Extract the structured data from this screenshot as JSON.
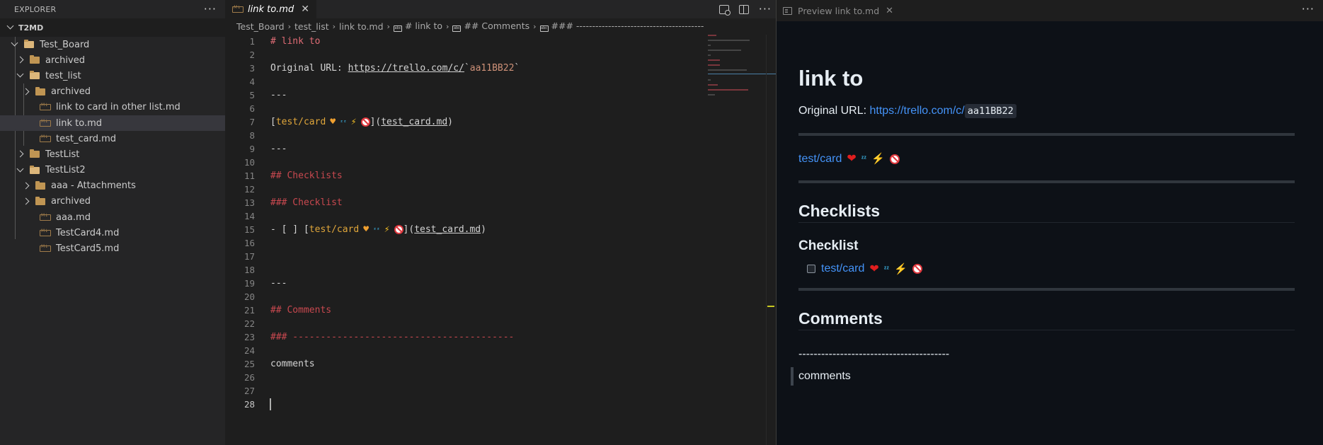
{
  "explorer": {
    "title": "EXPLORER",
    "workspace": "T2MD",
    "items": [
      {
        "label": "Test_Board",
        "type": "folder",
        "open": true,
        "depth": 1
      },
      {
        "label": "archived",
        "type": "folder",
        "open": false,
        "depth": 2
      },
      {
        "label": "test_list",
        "type": "folder",
        "open": true,
        "depth": 2
      },
      {
        "label": "archived",
        "type": "folder",
        "open": false,
        "depth": 3
      },
      {
        "label": "link to card in other list.md",
        "type": "file",
        "depth": 3
      },
      {
        "label": "link to.md",
        "type": "file",
        "depth": 3,
        "selected": true
      },
      {
        "label": "test_card.md",
        "type": "file",
        "depth": 3
      },
      {
        "label": "TestList",
        "type": "folder",
        "open": false,
        "depth": 2
      },
      {
        "label": "TestList2",
        "type": "folder",
        "open": true,
        "depth": 2
      },
      {
        "label": "aaa - Attachments",
        "type": "folder",
        "open": false,
        "depth": 3
      },
      {
        "label": "archived",
        "type": "folder",
        "open": false,
        "depth": 3
      },
      {
        "label": "aaa.md",
        "type": "file",
        "depth": 3
      },
      {
        "label": "TestCard4.md",
        "type": "file",
        "depth": 3
      },
      {
        "label": "TestCard5.md",
        "type": "file",
        "depth": 3
      }
    ]
  },
  "editor": {
    "tab_label": "link to.md",
    "breadcrumb": [
      "Test_Board",
      "test_list",
      "link to.md",
      "# link to",
      "## Comments",
      "### ----------------------------------------"
    ],
    "lines": [
      "# link to",
      "",
      "Original URL: https://trello.com/c/`aa11BB22`",
      "",
      "---",
      "",
      "[test/card 🧡 💤 ⚡ 🚫](test_card.md)",
      "",
      "---",
      "",
      "## Checklists",
      "",
      "### Checklist",
      "",
      "- [ ] [test/card 🧡 💤 ⚡ 🚫](test_card.md)",
      "",
      "",
      "",
      "---",
      "",
      "## Comments",
      "",
      "### ----------------------------------------",
      "",
      "comments",
      "",
      "",
      ""
    ],
    "line_numbers": [
      "1",
      "2",
      "3",
      "4",
      "5",
      "6",
      "7",
      "8",
      "9",
      "10",
      "11",
      "12",
      "13",
      "14",
      "15",
      "16",
      "17",
      "18",
      "19",
      "20",
      "21",
      "22",
      "23",
      "24",
      "25",
      "26",
      "27",
      "28"
    ],
    "active_line": 28,
    "parts": {
      "h1": "# link to",
      "url_prefix": "Original URL: ",
      "url": "https://trello.com/c/",
      "code": "aa11BB22",
      "hr": "---",
      "link_open": "[",
      "link_text": "test/card",
      "link_mid": "](",
      "link_target": "test_card.md",
      "link_close": ")",
      "h2_checklists": "## Checklists",
      "h3_checklist": "### Checklist",
      "task_prefix": "- [ ] ",
      "h2_comments": "## Comments",
      "h3_dashes": "### ----------------------------------------",
      "comments": "comments"
    }
  },
  "preview": {
    "tab_label": "Preview link to.md",
    "title": "link to",
    "url_label": "Original URL: ",
    "url": "https://trello.com/c/",
    "code": "aa11BB22",
    "link_text": "test/card",
    "h2_checklists": "Checklists",
    "h3_checklist": "Checklist",
    "task_text": "test/card",
    "h2_comments": "Comments",
    "dashes": "----------------------------------------",
    "quote": "comments"
  },
  "icons": {
    "more": "ellipsis-icon",
    "folder": "folder-icon",
    "markdown_file": "markdown-file-icon"
  },
  "colors": {
    "heading_red": "#c8484f",
    "link_orange": "#e0a63a",
    "preview_link": "#4493f8",
    "preview_bg": "#0d1117"
  }
}
